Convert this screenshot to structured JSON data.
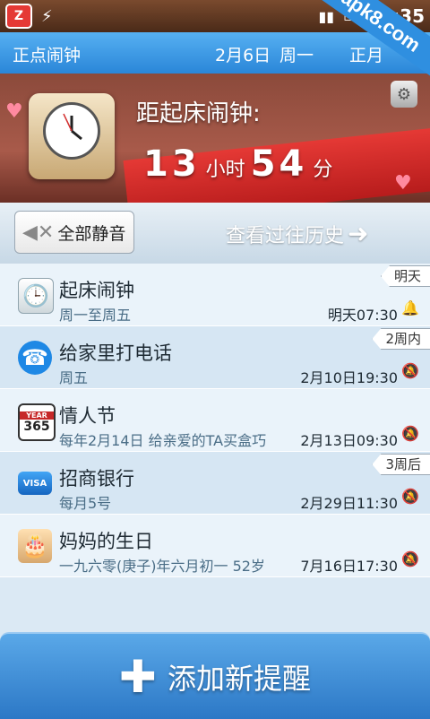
{
  "status_bar": {
    "time": ":35",
    "watermark": "apk8.com"
  },
  "header": {
    "title": "正点闹钟",
    "date": "2月6日",
    "weekday": "周一",
    "right_label": "正月"
  },
  "banner": {
    "title": "距起床闹钟:",
    "hours": "13",
    "hours_unit": "小时",
    "minutes": "54",
    "minutes_unit": "分"
  },
  "actions": {
    "mute_all_label": "全部静音",
    "history_label": "查看过往历史"
  },
  "alarms": [
    {
      "icon": "alarm-clock-icon",
      "title": "起床闹钟",
      "subtitle": "周一至周五",
      "time": "明天07:30",
      "bell": "on",
      "tag": "明天"
    },
    {
      "icon": "phone-icon",
      "title": "给家里打电话",
      "subtitle": "周五",
      "time": "2月10日19:30",
      "bell": "off",
      "tag": "2周内"
    },
    {
      "icon": "calendar-365-icon",
      "title": "情人节",
      "subtitle": "每年2月14日 给亲爱的TA买盒巧",
      "time": "2月13日09:30",
      "bell": "off",
      "tag": ""
    },
    {
      "icon": "credit-card-icon",
      "title": "招商银行",
      "subtitle": "每月5号",
      "time": "2月29日11:30",
      "bell": "off",
      "tag": "3周后"
    },
    {
      "icon": "birthday-cake-icon",
      "title": "妈妈的生日",
      "subtitle": "一九六零(庚子)年六月初一 52岁",
      "time": "7月16日17:30",
      "bell": "off",
      "tag": ""
    }
  ],
  "add_button": {
    "label": "添加新提醒"
  },
  "icon_text": {
    "calendar_year": "YEAR",
    "calendar_num": "365",
    "card_brand": "VISA"
  },
  "colors": {
    "title_bar": "#2a86d8",
    "bell_off": "#e53935",
    "accent": "#56b0f2"
  }
}
